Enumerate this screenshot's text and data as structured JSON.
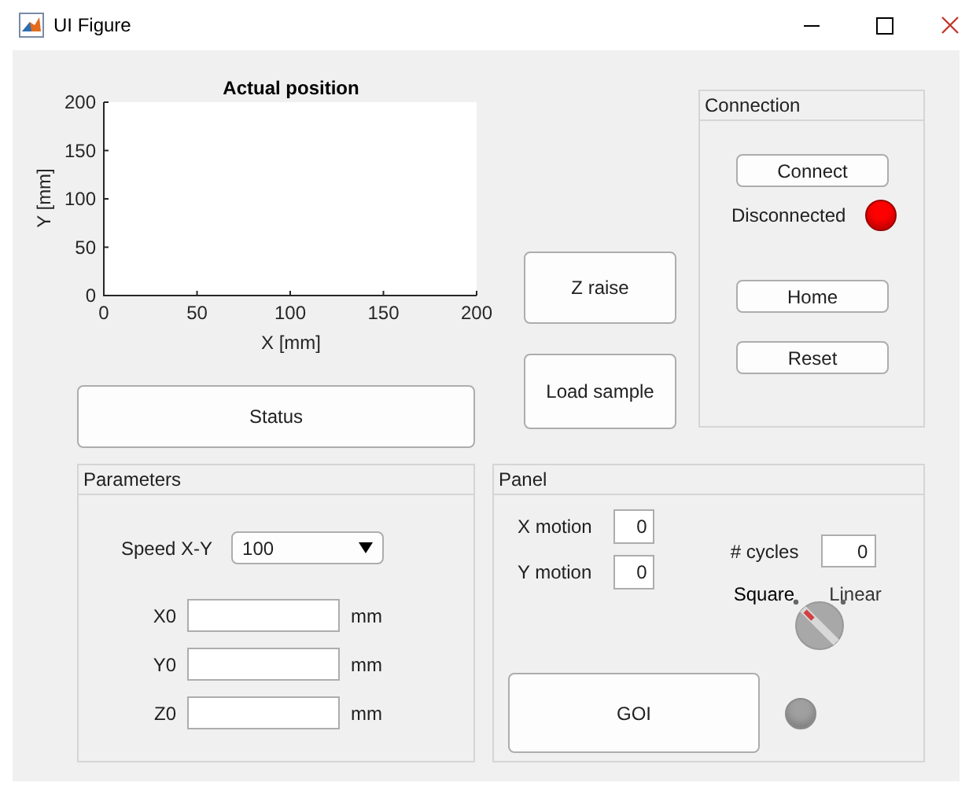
{
  "window": {
    "title": "UI Figure"
  },
  "chart": {
    "chart_data": {
      "type": "line",
      "title": "Actual position",
      "xlabel": "X [mm]",
      "ylabel": "Y [mm]",
      "xlim": [
        0,
        200
      ],
      "ylim": [
        0,
        200
      ],
      "xticks": [
        0,
        50,
        100,
        150,
        200
      ],
      "yticks": [
        0,
        50,
        100,
        150,
        200
      ]
    }
  },
  "status_button": {
    "label": "Status"
  },
  "actions": [
    {
      "label": "Z raise"
    },
    {
      "label": "Load sample"
    }
  ],
  "connection": {
    "title": "Connection",
    "connect_button": "Connect",
    "status": "Disconnected",
    "lamp": {
      "color": "#ff0000"
    },
    "buttons": [
      "Home",
      "Reset"
    ]
  },
  "parameters": {
    "title": "Parameters",
    "speed": {
      "label": "Speed X-Y",
      "value": "100"
    },
    "fields": [
      {
        "label": "X0",
        "unit": "mm"
      },
      {
        "label": "Y0",
        "unit": "mm"
      },
      {
        "label": "Z0",
        "unit": "mm"
      }
    ]
  },
  "panel": {
    "title": "Panel",
    "motions": [
      {
        "label": "X motion",
        "value": "0"
      },
      {
        "label": "Y motion",
        "value": "0"
      }
    ],
    "cycles": {
      "label": "# cycles",
      "value": "0"
    },
    "switch": [
      {
        "label": "Square",
        "selected": true
      },
      {
        "label": "Linear",
        "selected": false
      }
    ],
    "go_button": "GOI",
    "lamp": {
      "color": "#a0a0a0"
    }
  }
}
